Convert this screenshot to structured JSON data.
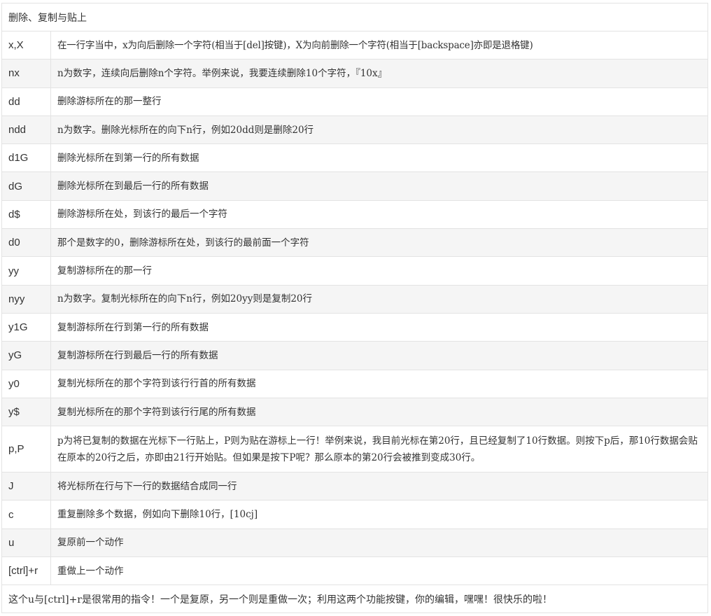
{
  "table": {
    "title": "删除、复制与贴上",
    "rows": [
      {
        "cmd": "x,X",
        "desc": "在一行字当中，x为向后删除一个字符(相当于[del]按键)，X为向前删除一个字符(相当于[backspace]亦即是退格键)"
      },
      {
        "cmd": "nx",
        "desc": "n为数字，连续向后删除n个字符。举例来说，我要连续删除10个字符，『10x』"
      },
      {
        "cmd": "dd",
        "desc": "删除游标所在的那一整行"
      },
      {
        "cmd": "ndd",
        "desc": "n为数字。删除光标所在的向下n行，例如20dd则是删除20行"
      },
      {
        "cmd": "d1G",
        "desc": "删除光标所在到第一行的所有数据"
      },
      {
        "cmd": "dG",
        "desc": "删除光标所在到最后一行的所有数据"
      },
      {
        "cmd": "d$",
        "desc": "删除游标所在处，到该行的最后一个字符"
      },
      {
        "cmd": "d0",
        "desc": "那个是数字的0，删除游标所在处，到该行的最前面一个字符"
      },
      {
        "cmd": "yy",
        "desc": "复制游标所在的那一行"
      },
      {
        "cmd": "nyy",
        "desc": "n为数字。复制光标所在的向下n行，例如20yy则是复制20行"
      },
      {
        "cmd": "y1G",
        "desc": "复制游标所在行到第一行的所有数据"
      },
      {
        "cmd": "yG",
        "desc": "复制游标所在行到最后一行的所有数据"
      },
      {
        "cmd": "y0",
        "desc": "复制光标所在的那个字符到该行行首的所有数据"
      },
      {
        "cmd": "y$",
        "desc": "复制光标所在的那个字符到该行行尾的所有数据"
      },
      {
        "cmd": "p,P",
        "desc": "p为将已复制的数据在光标下一行贴上，P则为贴在游标上一行！举例来说，我目前光标在第20行，且已经复制了10行数据。则按下p后，那10行数据会贴在原本的20行之后，亦即由21行开始贴。但如果是按下P呢？那么原本的第20行会被推到变成30行。"
      },
      {
        "cmd": "J",
        "desc": "将光标所在行与下一行的数据结合成同一行"
      },
      {
        "cmd": "c",
        "desc": "重复删除多个数据，例如向下删除10行，[10cj]"
      },
      {
        "cmd": "u",
        "desc": "复原前一个动作"
      },
      {
        "cmd": "[ctrl]+r",
        "desc": "重做上一个动作"
      }
    ],
    "note": "这个u与[ctrl]+r是很常用的指令！一个是复原，另一个则是重做一次；利用这两个功能按键，你的编辑，嘿嘿！很快乐的啦！"
  }
}
